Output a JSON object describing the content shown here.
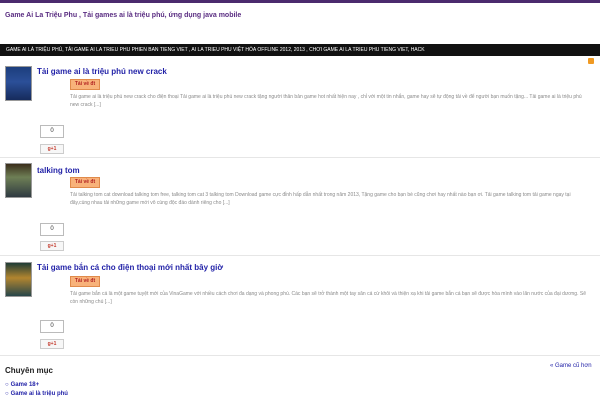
{
  "site": {
    "title": "Game Ai La Triệu Phu , Tải games ai là triệu phú, ứng dụng java mobile"
  },
  "nav": {
    "text": "GAME AI LÀ TRIỆU PHÚ, TẢI GAME AI LA TRIEU PHU PHIEN BAN TIENG VIET , AI LA TRIEU PHU VIỆT HÓA OFFLINE 2012, 2013 , CHƠI GAME AI LA TRIEU PHU TIENG VIET, HACK"
  },
  "posts": [
    {
      "title": "Tải game ai là triệu phú new crack",
      "button": "Tải về đt",
      "excerpt": "Tải game ai là triệu phú new crack cho điện thoại Tải game ai là triệu phú new crack tặng người thân bản game hot nhất hiện nay , chỉ với một tin nhắn, game hay sẽ tự động tải về để người bạn muốn tặng... Tải game ai là triệu phú new crack [...]",
      "count": "0",
      "gplus": "g+1"
    },
    {
      "title": "talking tom",
      "button": "Tải về đt",
      "excerpt": "Tải talking tom cat download talking tom free, talking tom cat 3 talking tom Download game cực đỉnh hấp dẫn nhất trong năm 2013, Tặng game cho bạn bè cũng chơi hay nhất nào bạn ơi. Tải game talking tom tải game ngay tại đây,cùng nhau tải những game mới vô cùng độc đáo dành riêng cho [...]",
      "count": "0",
      "gplus": "g+1"
    },
    {
      "title": "Tải game bắn cá cho điện thoại mới nhất bây giờ",
      "button": "Tải về đt",
      "excerpt": "Tải game bắn cá là một game tuyệt mới của VinaGame với nhiều cách chơi đa dạng và phong phú. Các bạn sẽ trở thành một tay săn cá cừ khôi và thiện xạ khi tải game bắn cá bạn sẽ được hòa mình vào lãn nước của đại dương. Sẽ còn những chú [...]",
      "count": "0",
      "gplus": "g+1"
    }
  ],
  "footer": {
    "section_heading": "Chuyên mục",
    "older_link": "« Game cũ hơn",
    "categories": [
      "Game 18+",
      "Game ai là triệu phú"
    ]
  }
}
